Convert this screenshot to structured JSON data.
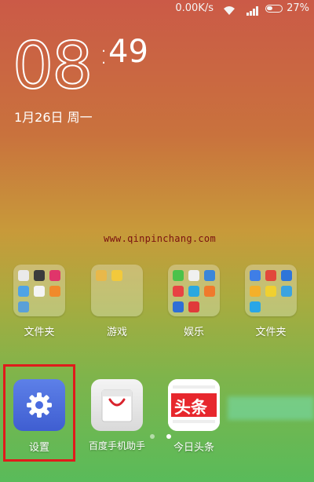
{
  "status_bar": {
    "speed": "0.00K/s",
    "battery": "27%"
  },
  "clock": {
    "hours": "08",
    "minutes": "49"
  },
  "date": "1月26日 周一",
  "watermark": "www.qinpinchang.com",
  "folders": [
    {
      "label": "文件夹"
    },
    {
      "label": "游戏"
    },
    {
      "label": "娱乐"
    },
    {
      "label": "文件夹"
    }
  ],
  "dock": [
    {
      "label": "设置",
      "icon": "gear-icon"
    },
    {
      "label": "百度手机助手",
      "icon": "shopping-bag-icon"
    },
    {
      "label": "今日头条",
      "icon": "news-icon",
      "logo_text": "头条"
    }
  ],
  "colors": {
    "highlight": "#e01b1b",
    "settings": "#4a6be0",
    "toutiao": "#e7272d"
  }
}
